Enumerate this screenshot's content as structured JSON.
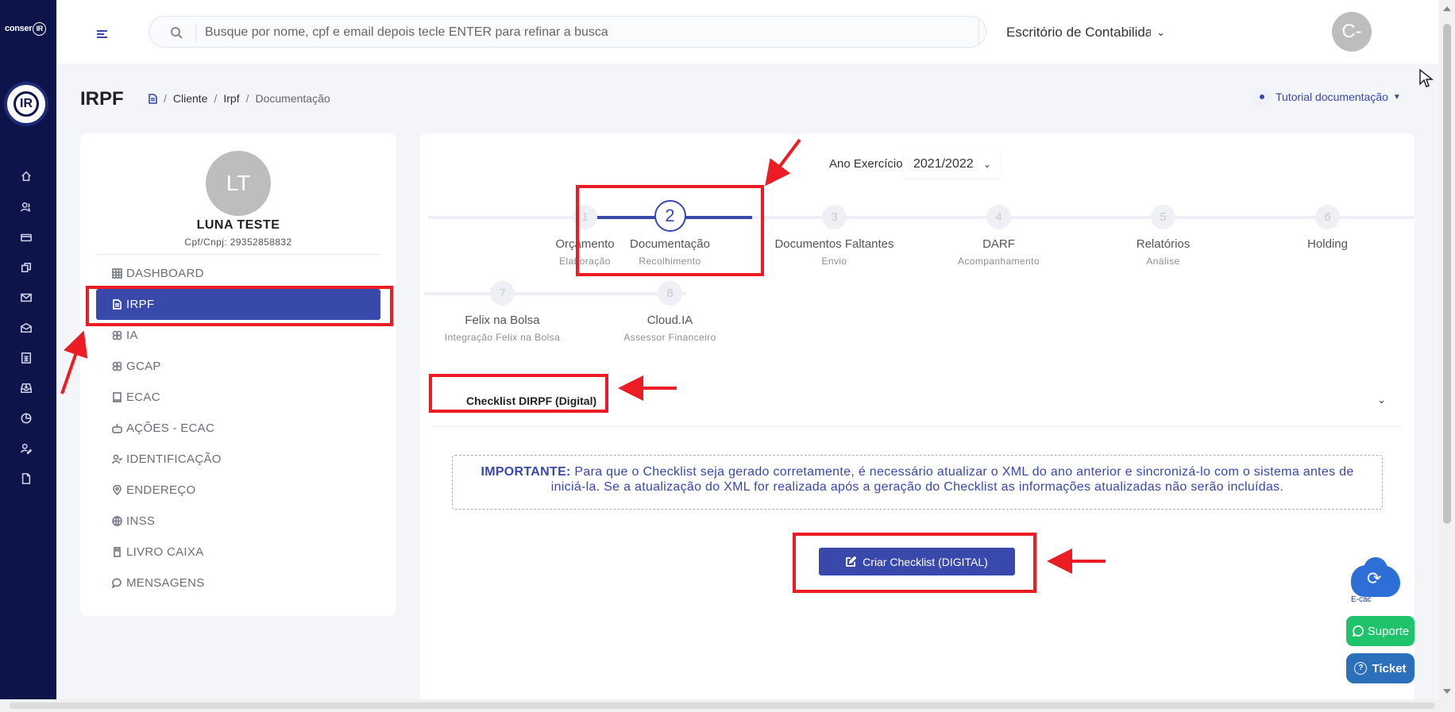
{
  "app": {
    "logo_text": "conser",
    "logo_badge": "IR",
    "emblem_text": "IR"
  },
  "header": {
    "search_placeholder": "Busque por nome, cpf e email depois tecle ENTER para refinar a busca",
    "office_name": "Escritório de Contabilidade Co",
    "avatar_initials": "C-"
  },
  "page": {
    "title": "IRPF",
    "breadcrumb": [
      "Cliente",
      "Irpf",
      "Documentação"
    ],
    "tutorial_label": "Tutorial documentação"
  },
  "client": {
    "initials": "LT",
    "name": "LUNA TESTE",
    "document": "Cpf/Cnpj: 29352858832",
    "nav": [
      {
        "label": "DASHBOARD",
        "icon": "grid-icon"
      },
      {
        "label": "IRPF",
        "icon": "document-icon",
        "active": true
      },
      {
        "label": "IA",
        "icon": "brain-icon"
      },
      {
        "label": "GCAP",
        "icon": "brain-icon"
      },
      {
        "label": "ECAC",
        "icon": "book-icon"
      },
      {
        "label": "AÇÕES - ECAC",
        "icon": "robot-icon"
      },
      {
        "label": "IDENTIFICAÇÃO",
        "icon": "user-check-icon"
      },
      {
        "label": "ENDEREÇO",
        "icon": "map-pin-icon"
      },
      {
        "label": "INSS",
        "icon": "globe-icon"
      },
      {
        "label": "LIVRO CAIXA",
        "icon": "book-icon"
      },
      {
        "label": "MENSAGENS",
        "icon": "chat-icon"
      }
    ]
  },
  "main": {
    "year_label": "Ano Exercício",
    "year_value": "2021/2022",
    "steps": [
      {
        "num": "1",
        "label": "Orçamento",
        "sub": "Elaboração"
      },
      {
        "num": "2",
        "label": "Documentação",
        "sub": "Recolhimento",
        "active": true
      },
      {
        "num": "3",
        "label": "Documentos Faltantes",
        "sub": "Envio"
      },
      {
        "num": "4",
        "label": "DARF",
        "sub": "Acompanhamento"
      },
      {
        "num": "5",
        "label": "Relatórios",
        "sub": "Análise"
      },
      {
        "num": "6",
        "label": "Holding",
        "sub": ""
      },
      {
        "num": "7",
        "label": "Felix na Bolsa",
        "sub": "Integração Felix na Bolsa"
      },
      {
        "num": "8",
        "label": "Cloud.IA",
        "sub": "Assessor Financeiro"
      }
    ],
    "checklist_title": "Checklist DIRPF (Digital)",
    "notice_strong": "IMPORTANTE:",
    "notice_text": " Para que o Checklist seja gerado corretamente, é necessário atualizar o XML do ano anterior e sincronizá-lo com o sistema antes de iniciá-la. Se a atualização do XML for realizada após a geração do Checklist as informações atualizadas não serão incluídas.",
    "create_button": "Criar Checklist (DIGITAL)"
  },
  "widgets": {
    "ecac_label": "E-cac",
    "support_label": "Suporte",
    "ticket_label": "Ticket"
  },
  "colors": {
    "rail": "#0d1449",
    "accent": "#3949ab",
    "annotation": "#ec1c24",
    "support": "#1fc46a",
    "ticket": "#2c6fba"
  }
}
